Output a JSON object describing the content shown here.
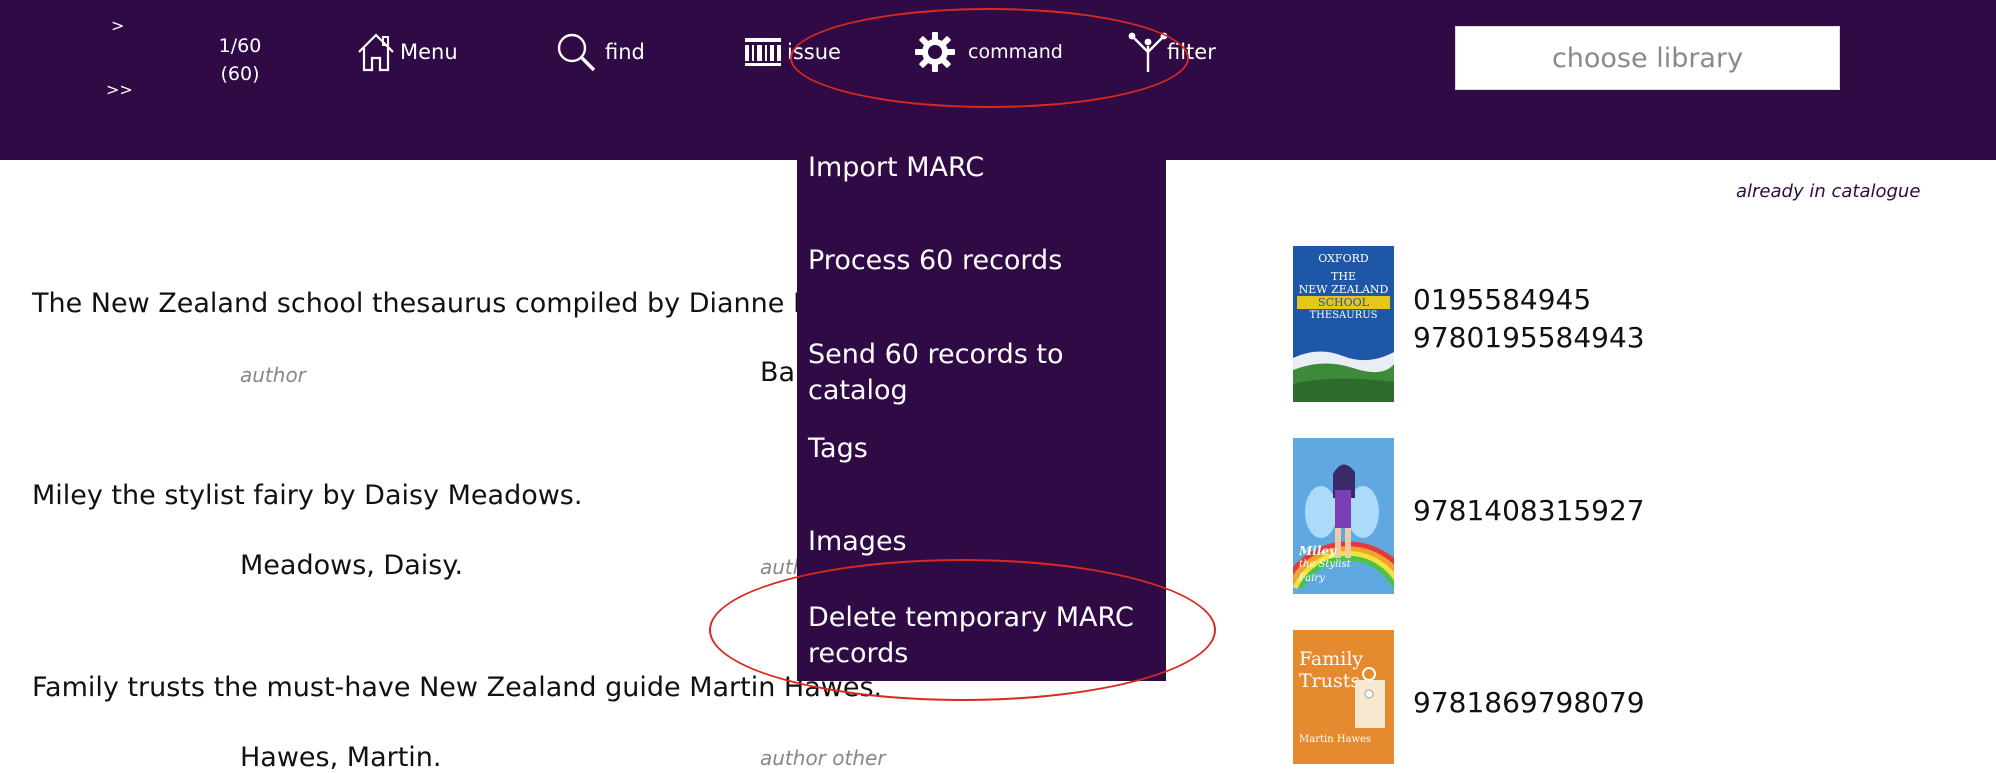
{
  "header": {
    "next_label": ">",
    "last_label": ">>",
    "page_position": "1/60",
    "page_total": "(60)",
    "nav": {
      "menu": "Menu",
      "find": "find",
      "issue": "issue",
      "command": "command",
      "filter": "filter"
    },
    "library_placeholder": "choose library",
    "background_color": "#2f0a45"
  },
  "command_menu": {
    "items": [
      "Import MARC",
      "Process 60 records",
      "Send 60 records to catalog",
      "Tags",
      "Images",
      "Delete temporary MARC records"
    ]
  },
  "status_note": "already in catalogue",
  "records": [
    {
      "title": "The New Zealand school thesaurus compiled by Dianne Ba",
      "author_label": "author",
      "author_partial": "Ba",
      "isbns": [
        "0195584945",
        "9780195584943"
      ],
      "cover_texts": [
        "OXFORD",
        "THE",
        "NEW ZEALAND",
        "SCHOOL",
        "THESAURUS"
      ]
    },
    {
      "title": "Miley the stylist fairy by Daisy Meadows.",
      "author": "Meadows, Daisy.",
      "author_label": "auth",
      "isbns": [
        "9781408315927"
      ],
      "cover_texts": [
        "Miley",
        "the Stylist",
        "Fairy"
      ]
    },
    {
      "title": "Family trusts the must-have New Zealand guide Martin Hawes.",
      "author": "Hawes, Martin.",
      "author_label": "author other",
      "isbns": [
        "9781869798079"
      ],
      "cover_texts": [
        "Family",
        "Trusts",
        "Martin Hawes"
      ]
    }
  ],
  "colors": {
    "accent": "#2f0a45",
    "annotation": "#d8291f"
  }
}
